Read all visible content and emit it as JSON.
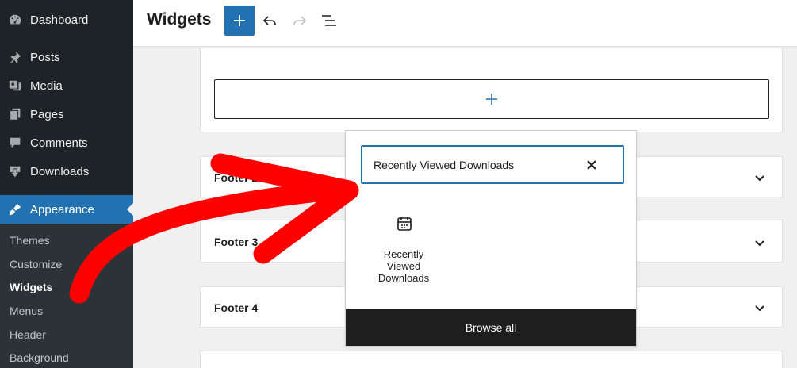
{
  "sidebar": {
    "items": [
      {
        "label": "Dashboard",
        "icon": "dashboard-icon"
      },
      {
        "label": "Posts",
        "icon": "pin-icon"
      },
      {
        "label": "Media",
        "icon": "media-icon"
      },
      {
        "label": "Pages",
        "icon": "pages-icon"
      },
      {
        "label": "Comments",
        "icon": "comment-icon"
      },
      {
        "label": "Downloads",
        "icon": "download-icon"
      },
      {
        "label": "Appearance",
        "icon": "paintbrush-icon",
        "active": true
      }
    ],
    "submenu": [
      "Themes",
      "Customize",
      "Widgets",
      "Menus",
      "Header",
      "Background"
    ],
    "current_submenu": "Widgets"
  },
  "header": {
    "title": "Widgets"
  },
  "content": {
    "footers": [
      "Footer 2",
      "Footer 3",
      "Footer 4"
    ]
  },
  "inserter": {
    "search_value": "Recently Viewed Downloads",
    "result_label": "Recently Viewed Downloads",
    "browse_all": "Browse all"
  },
  "colors": {
    "sidebar_bg": "#1d2327",
    "accent": "#2271b1",
    "arrow": "#ff0000"
  }
}
